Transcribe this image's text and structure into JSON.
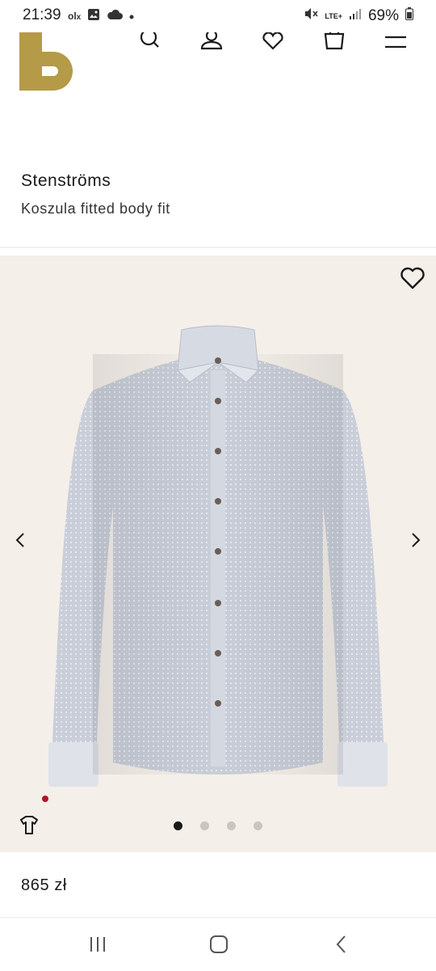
{
  "status_bar": {
    "time": "21:39",
    "left_icons": [
      "olx-icon",
      "image-icon",
      "cloud-icon",
      "dot-icon"
    ],
    "network": "LTE+",
    "battery": "69%"
  },
  "header": {
    "logo": "Breuninger logo",
    "logo_color": "#b59a47",
    "icons": [
      "search-icon",
      "account-icon",
      "wishlist-icon",
      "bag-icon",
      "menu-icon"
    ]
  },
  "product": {
    "brand": "Stenströms",
    "name": "Koszula fitted body fit",
    "price": "865 zł"
  },
  "gallery": {
    "background": "#f4efe9",
    "image": "light blue dotted shirt",
    "images_count": 4,
    "active_index": 0
  },
  "nav": {
    "items": [
      "recent-apps-icon",
      "home-icon",
      "back-icon"
    ]
  }
}
